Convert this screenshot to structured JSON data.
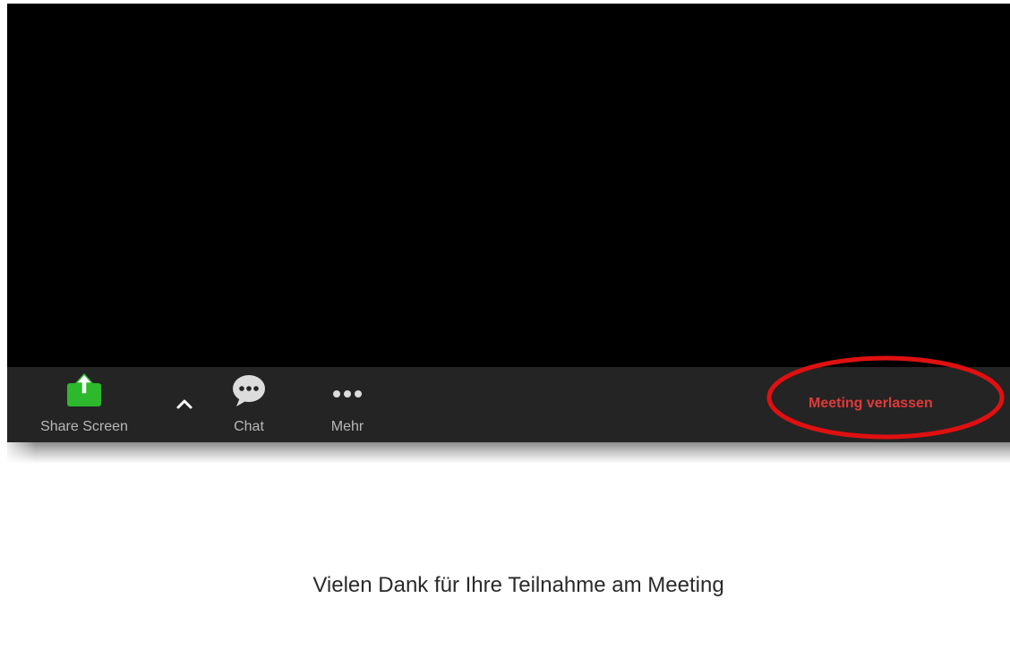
{
  "toolbar": {
    "share_label": "Share Screen",
    "chat_label": "Chat",
    "more_label": "Mehr",
    "leave_label": "Meeting verlassen"
  },
  "icons": {
    "share": "share-screen-icon",
    "caret": "chevron-up-icon",
    "chat": "chat-bubble-icon",
    "more": "more-dots-icon"
  },
  "colors": {
    "toolbar_bg": "#242424",
    "share_green": "#2db82d",
    "leave_red": "#e03a3a",
    "annotation_red": "#e01010"
  },
  "end_screen": {
    "message": "Vielen Dank für Ihre Teilnahme am Meeting"
  }
}
